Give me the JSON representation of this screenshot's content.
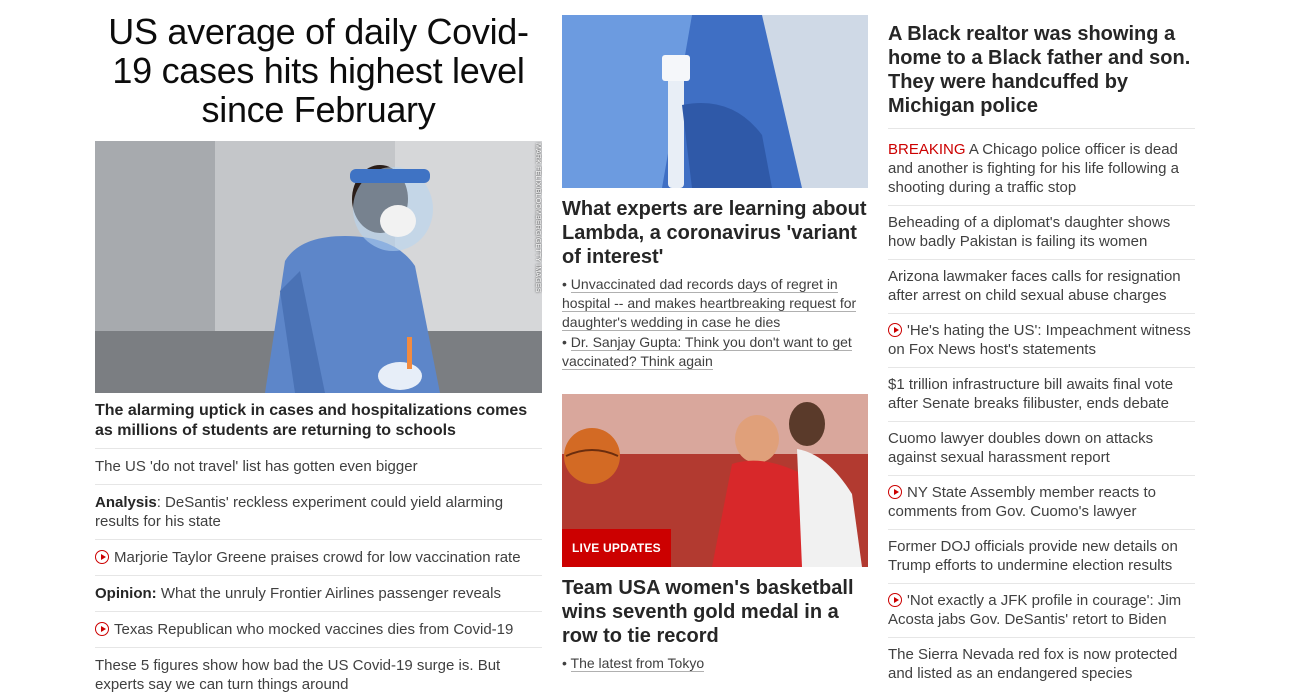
{
  "col1": {
    "headline": "US average of daily Covid-19 cases hits highest level since February",
    "image_credit": "MARK FELIX/BLOOMBERG/GETTY IMAGES",
    "subhead": "The alarming uptick in cases and hospitalizations comes as millions of students are returning to schools",
    "items": [
      {
        "prefix": "",
        "text": "The US 'do not travel' list has gotten even bigger",
        "video": false
      },
      {
        "prefix": "Analysis",
        "sep": ": ",
        "text": "DeSantis' reckless experiment could yield alarming results for his state",
        "video": false
      },
      {
        "prefix": "",
        "text": "Marjorie Taylor Greene praises crowd for low vaccination rate",
        "video": true
      },
      {
        "prefix": "Opinion:",
        "sep": " ",
        "text": "What the unruly Frontier Airlines passenger reveals",
        "video": false
      },
      {
        "prefix": "",
        "text": "Texas Republican who mocked vaccines dies from Covid-19",
        "video": true
      },
      {
        "prefix": "",
        "text": "These 5 figures show how bad the US Covid-19 surge is. But experts say we can turn things around",
        "video": false
      }
    ]
  },
  "col2": {
    "story1": {
      "headline": "What experts are learning about Lambda, a coronavirus 'variant of interest'",
      "bullets": [
        "Unvaccinated dad records days of regret in hospital -- and makes heartbreaking request for daughter's wedding in case he dies",
        "Dr. Sanjay Gupta: Think you don't want to get vaccinated? Think again"
      ]
    },
    "story2": {
      "badge": "LIVE UPDATES",
      "headline": "Team USA women's basketball wins seventh gold medal in a row to tie record",
      "bullets": [
        "The latest from Tokyo"
      ]
    }
  },
  "col3": {
    "headline": "A Black realtor was showing a home to a Black father and son. They were handcuffed by Michigan police",
    "items": [
      {
        "breaking": "BREAKING",
        "text": "A Chicago police officer is dead and another is fighting for his life following a shooting during a traffic stop",
        "video": false
      },
      {
        "breaking": "",
        "text": "Beheading of a diplomat's daughter shows how badly Pakistan is failing its women",
        "video": false
      },
      {
        "breaking": "",
        "text": "Arizona lawmaker faces calls for resignation after arrest on child sexual abuse charges",
        "video": false
      },
      {
        "breaking": "",
        "text": "'He's hating the US': Impeachment witness on Fox News host's statements",
        "video": true
      },
      {
        "breaking": "",
        "text": "$1 trillion infrastructure bill awaits final vote after Senate breaks filibuster, ends debate",
        "video": false
      },
      {
        "breaking": "",
        "text": "Cuomo lawyer doubles down on attacks against sexual harassment report",
        "video": false
      },
      {
        "breaking": "",
        "text": "NY State Assembly member reacts to comments from Gov. Cuomo's lawyer",
        "video": true
      },
      {
        "breaking": "",
        "text": "Former DOJ officials provide new details on Trump efforts to undermine election results",
        "video": false
      },
      {
        "breaking": "",
        "text": "'Not exactly a JFK profile in courage': Jim Acosta jabs Gov. DeSantis' retort to Biden",
        "video": true
      },
      {
        "breaking": "",
        "text": "The Sierra Nevada red fox is now protected and listed as an endangered species",
        "video": false
      }
    ]
  },
  "colors": {
    "accent_red": "#cc0000",
    "text_dark": "#262626",
    "divider": "#e6e6e6"
  }
}
